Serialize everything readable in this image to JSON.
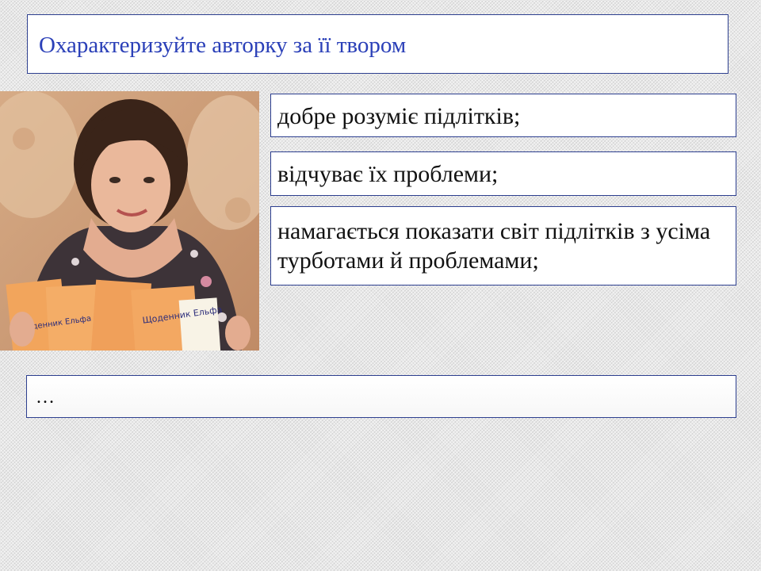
{
  "slide": {
    "title": "Охарактеризуйте авторку за її твором",
    "points": [
      "добре розуміє підлітків;",
      "відчуває їх проблеми;",
      "намагається показати світ підлітків з усіма турботами й проблемами;"
    ],
    "ellipsis": "…",
    "colors": {
      "title": "#2b40b8",
      "border": "#2d3f8f",
      "book_cover": "#f2a55c"
    }
  },
  "photo": {
    "book_title": "Щоденник Ельфа"
  }
}
